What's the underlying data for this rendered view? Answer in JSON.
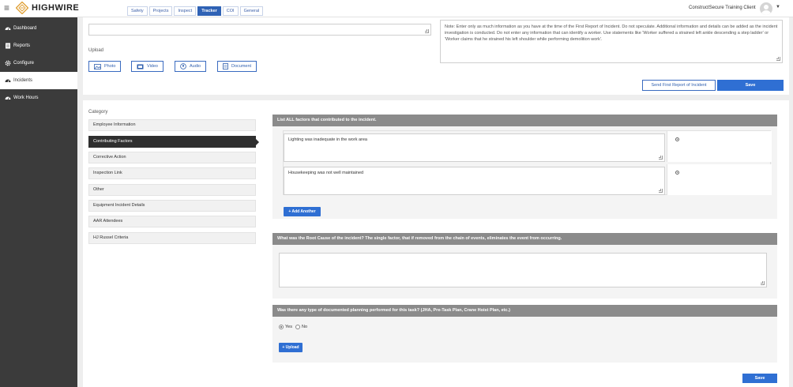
{
  "app": {
    "logo_text": "HIGHWIRE",
    "tabs": [
      {
        "label": "Safety",
        "active": false
      },
      {
        "label": "Projects",
        "active": false
      },
      {
        "label": "Inspect",
        "active": false
      },
      {
        "label": "Tracker",
        "active": true
      },
      {
        "label": "COI",
        "active": false
      },
      {
        "label": "General",
        "active": false
      }
    ],
    "client_name": "ConstructSecure Training Client"
  },
  "sidebar": {
    "items": [
      {
        "label": "Dashboard",
        "icon": "dashboard-icon",
        "active": false
      },
      {
        "label": "Reports",
        "icon": "report-icon",
        "active": false
      },
      {
        "label": "Configure",
        "icon": "gear-icon",
        "active": false
      },
      {
        "label": "Incidents",
        "icon": "dashboard-icon",
        "active": true
      },
      {
        "label": "Work Hours",
        "icon": "dashboard-icon",
        "active": false
      }
    ]
  },
  "top_form": {
    "upload_label": "Upload",
    "upload_buttons": [
      {
        "label": "Photo",
        "icon": "photo-icon"
      },
      {
        "label": "Video",
        "icon": "video-icon"
      },
      {
        "label": "Audio",
        "icon": "audio-icon"
      },
      {
        "label": "Document",
        "icon": "document-icon"
      }
    ],
    "note": "Note: Enter only as much information as you have at the time of the First Report of Incident. Do not speculate. Additional information and details can be added as the incident investigation is conducted.  Do not enter any information that can identify a worker.  Use statements like 'Worker suffered a strained left ankle descending a step ladder' or 'Worker claims that he strained his left shoulder while performing demolition work'.",
    "send_report_label": "Send First Report of Incident",
    "save_label": "Save"
  },
  "categories": {
    "label": "Category",
    "items": [
      {
        "label": "Employee Information",
        "active": false
      },
      {
        "label": "Contributing Factors",
        "active": true
      },
      {
        "label": "Corrective Action",
        "active": false
      },
      {
        "label": "Inspection Link",
        "active": false
      },
      {
        "label": "Other",
        "active": false
      },
      {
        "label": "Equipment Incident Details",
        "active": false
      },
      {
        "label": "AAR Attendees",
        "active": false
      },
      {
        "label": "HJ Russel Criteria",
        "active": false
      }
    ]
  },
  "contributing": {
    "header": "List ALL factors that contributed to the incident.",
    "factors": [
      "Lighting was inadequate in the work area",
      "Housekeeping was not well maintained"
    ],
    "add_label": "+ Add Another"
  },
  "root_cause": {
    "header": "What was the Root Cause of the incident? The single factor, that if removed from the chain of events, eliminates the event from occurring.",
    "value": ""
  },
  "planning": {
    "header": "Was there any type of documented planning performed for this task? (JHA, Pre-Task Plan, Crane Hoist Plan, etc.)",
    "yes_label": "Yes",
    "no_label": "No",
    "selected": "Yes",
    "upload_label": "+ Upload"
  },
  "footer": {
    "save_label": "Save"
  }
}
